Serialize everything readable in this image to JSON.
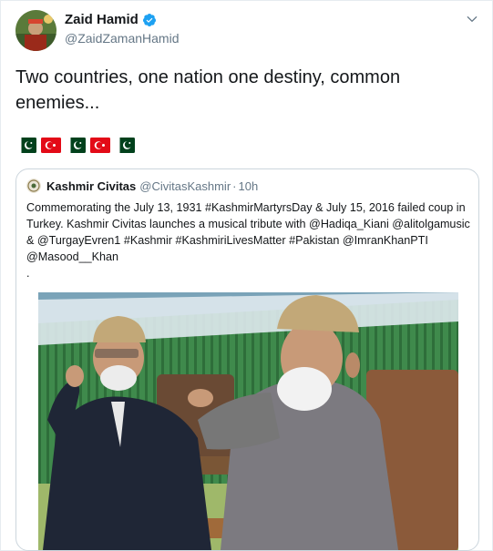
{
  "author": {
    "name": "Zaid Hamid",
    "handle": "@ZaidZamanHamid"
  },
  "tweet": {
    "text": "Two countries, one nation one destiny, common enemies...",
    "flags": [
      "pakistan-flag",
      "turkey-flag",
      "pakistan-flag",
      "turkey-flag",
      "pakistan-flag"
    ]
  },
  "quoted_tweet": {
    "name": "Kashmir Civitas",
    "handle": "@CivitasKashmir",
    "separator": "·",
    "time": "10h",
    "text": "Commemorating the July 13, 1931 #KashmirMartyrsDay & July 15, 2016 failed coup in Turkey. Kashmir Civitas launches a musical tribute with @Hadiqa_Kiani @alitolgamusic & @TurgayEvren1 #Kashmir #KashmiriLivesMatter #Pakistan @ImranKhanPTI @Masood__Khan\n."
  },
  "icons": {
    "verified": "verified-badge-icon",
    "menu": "chevron-down-icon"
  },
  "colors": {
    "verified": "#1da1f2",
    "secondary_text": "#657786",
    "border": "#ccd6dd",
    "pakistan_green": "#01411c",
    "turkey_red": "#e30a17"
  }
}
